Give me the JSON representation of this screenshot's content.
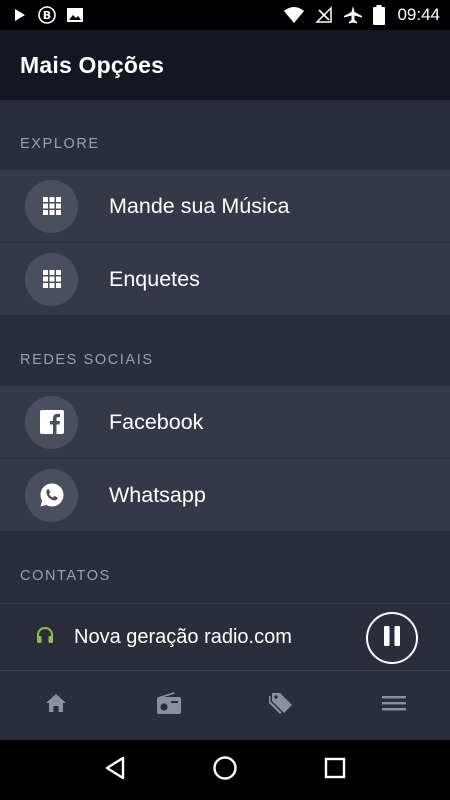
{
  "status_bar": {
    "time": "09:44",
    "left_icons": [
      "play-store-icon",
      "bitcoin-icon",
      "image-icon"
    ],
    "right_icons": [
      "wifi-icon",
      "no-signal-icon",
      "airplane-icon",
      "battery-icon"
    ]
  },
  "header": {
    "title": "Mais Opções"
  },
  "sections": [
    {
      "title": "EXPLORE",
      "items": [
        {
          "label": "Mande sua Música",
          "icon": "grid-icon"
        },
        {
          "label": "Enquetes",
          "icon": "grid-icon"
        }
      ]
    },
    {
      "title": "REDES SOCIAIS",
      "items": [
        {
          "label": "Facebook",
          "icon": "facebook-icon"
        },
        {
          "label": "Whatsapp",
          "icon": "whatsapp-icon"
        }
      ]
    },
    {
      "title": "CONTATOS",
      "items": []
    }
  ],
  "player": {
    "title": "Nova geração radio.com",
    "icon": "headphones-icon",
    "button": "pause-icon"
  },
  "bottom_nav": [
    "home-icon",
    "radio-icon",
    "tags-icon",
    "menu-icon"
  ],
  "system_nav": [
    "back-icon",
    "home-circle-icon",
    "recents-icon"
  ],
  "colors": {
    "background": "#2a2e3b",
    "header": "#141722",
    "list_item": "#343847",
    "icon_circle": "#4a4f5e",
    "section_text": "#9aa0ae",
    "headphones": "#8fbf4a"
  }
}
